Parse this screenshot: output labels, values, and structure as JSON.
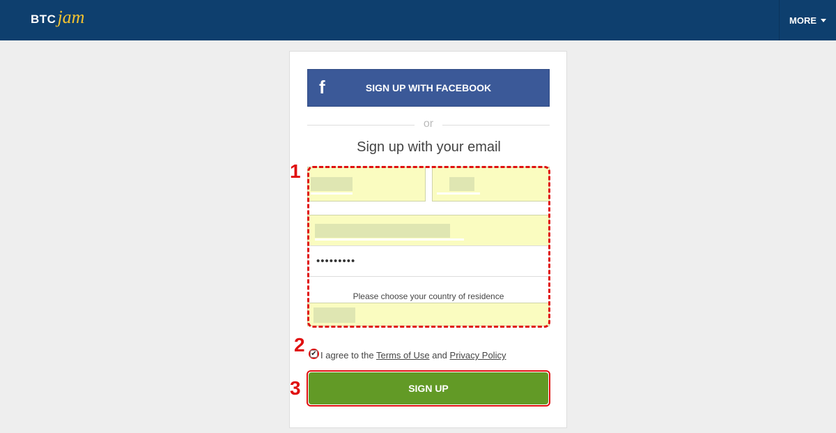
{
  "header": {
    "logo_part1": "BTC",
    "logo_part2": "jam",
    "more_label": "MORE"
  },
  "signup": {
    "facebook_label": "SIGN UP WITH FACEBOOK",
    "or_label": "or",
    "heading": "Sign up with your email",
    "password_value": "•••••••••",
    "country_prompt": "Please choose your country of residence",
    "agree_prefix": "I agree to the",
    "terms_label": "Terms of Use",
    "agree_mid": "and",
    "privacy_label": "Privacy Policy",
    "submit_label": "SIGN UP",
    "terms_checked": true
  },
  "annotations": [
    "1",
    "2",
    "3"
  ],
  "colors": {
    "nav_bg": "#0e3f6e",
    "facebook_blue": "#3b5998",
    "signup_green": "#629a26",
    "annotation_red": "#e01010",
    "autofill_yellow": "#fafcc0"
  },
  "icons": {
    "facebook": "facebook-icon",
    "dropdown": "chevron-down-icon",
    "checkbox": "checkbox-icon"
  }
}
